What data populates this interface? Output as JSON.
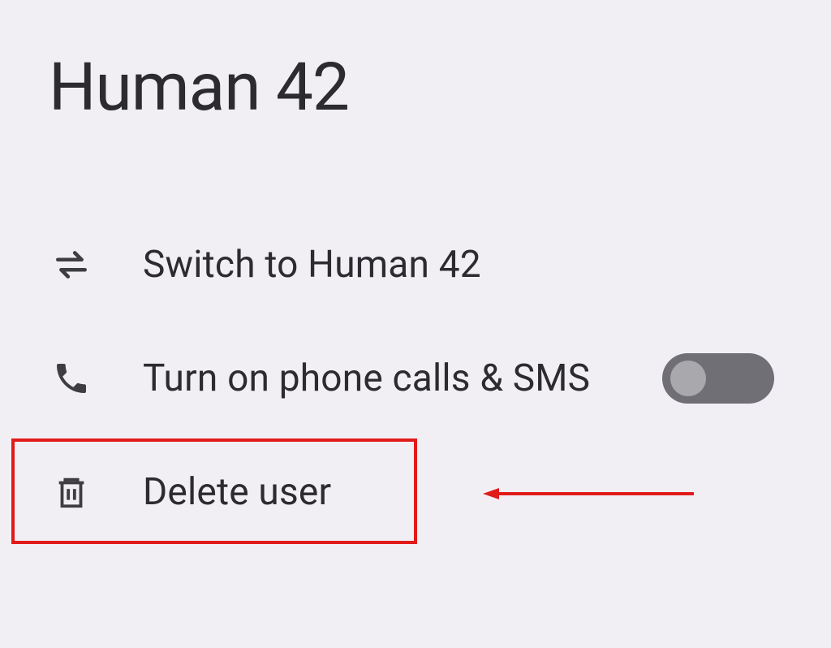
{
  "page": {
    "title": "Human 42"
  },
  "settings": [
    {
      "icon": "swap-icon",
      "label": "Switch to Human 42",
      "hasToggle": false
    },
    {
      "icon": "phone-icon",
      "label": "Turn on phone calls & SMS",
      "hasToggle": true,
      "toggleOn": false
    },
    {
      "icon": "trash-icon",
      "label": "Delete user",
      "hasToggle": false,
      "highlighted": true
    }
  ],
  "annotation": {
    "highlightColor": "#e11a1a",
    "arrowPointsTo": "delete-user"
  }
}
